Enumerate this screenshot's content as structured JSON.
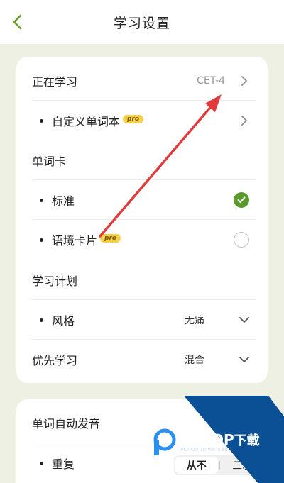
{
  "header": {
    "title": "学习设置"
  },
  "settings": {
    "studying_label": "正在学习",
    "studying_value": "CET-4",
    "custom_book_label": "自定义单词本",
    "pro_badge": "pro",
    "card_section_label": "单词卡",
    "standard_label": "标准",
    "context_card_label": "语境卡片",
    "plan_section_label": "学习计划",
    "style_label": "风格",
    "style_value": "无痛",
    "priority_label": "优先学习",
    "priority_value": "混合",
    "auto_pronounce_label": "单词自动发音",
    "repeat_label": "重复",
    "repeat_options": [
      "从不",
      "三次"
    ],
    "repeat_selected": "从不"
  },
  "watermark": {
    "brand": "PCPOP",
    "brand_cn": "下载",
    "sub": "PCPOP Download"
  },
  "colors": {
    "accent": "#5a9a2c",
    "back_arrow": "#6aa02c",
    "pro": "#f6cf4a",
    "annotation_arrow": "#e23b3b",
    "watermark_blue": "#0b4f95"
  },
  "icons": {
    "back": "chevron-left-icon",
    "more": "chevron-right-icon",
    "dropdown": "chevron-down-icon",
    "selected": "check-circle-icon",
    "unselected": "radio-empty-icon"
  }
}
